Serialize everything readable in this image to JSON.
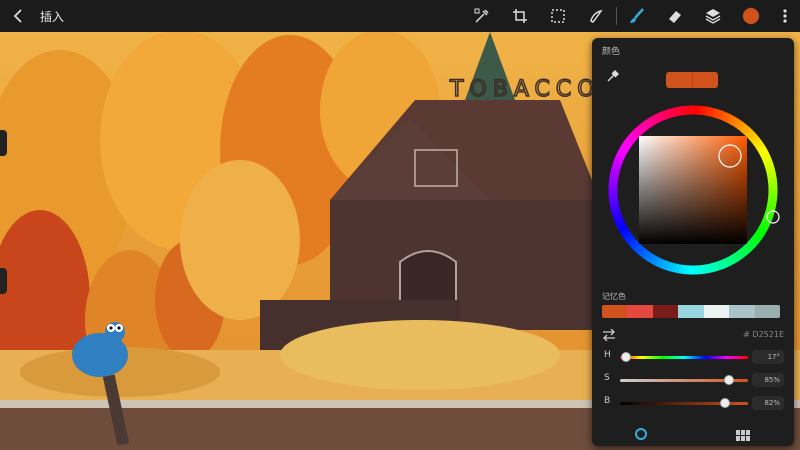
{
  "topbar": {
    "insert_label": "插入",
    "icons": [
      "back-arrow-icon",
      "adjust-wand-icon",
      "transform-crop-icon",
      "selection-icon",
      "smudge-icon",
      "brush-icon",
      "eraser-icon",
      "layers-icon",
      "color-swatch-icon",
      "more-menu-icon"
    ],
    "active_color": "#D2521E"
  },
  "canvas": {
    "sign_text": "TOBACCO"
  },
  "color_panel": {
    "title": "颜色",
    "memory_title": "记忆色",
    "current_swatch": [
      "#D2521E",
      "#D2521E"
    ],
    "palette": [
      "#D2521E",
      "#E4483F",
      "#7A1D1A",
      "#98D7E0",
      "#EAF3F2",
      "#A8C4C6",
      "#9AB0AE"
    ],
    "hex_label": "# D2521E",
    "sliders": [
      {
        "label": "H",
        "value_text": "17°",
        "fraction": 0.047
      },
      {
        "label": "S",
        "value_text": "85%",
        "fraction": 0.85
      },
      {
        "label": "B",
        "value_text": "82%",
        "fraction": 0.82
      }
    ],
    "tabs": [
      "disc-tab-icon",
      "palettes-tab-icon"
    ]
  }
}
